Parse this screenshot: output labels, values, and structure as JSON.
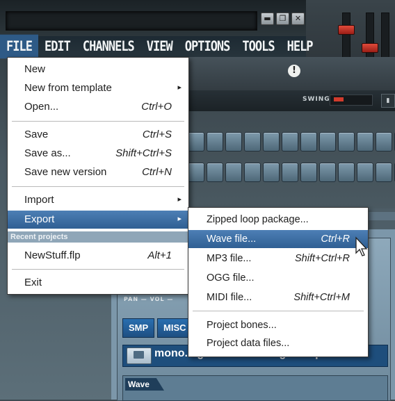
{
  "menubar": {
    "items": [
      "FILE",
      "EDIT",
      "CHANNELS",
      "VIEW",
      "OPTIONS",
      "TOOLS",
      "HELP"
    ]
  },
  "window_buttons": [
    "▬",
    "❐",
    "✕"
  ],
  "swing_label": "SWING",
  "file_menu": {
    "items": [
      {
        "label": "New",
        "shortcut": "",
        "submenu": false
      },
      {
        "label": "New from template",
        "shortcut": "",
        "submenu": true
      },
      {
        "label": "Open...",
        "shortcut": "Ctrl+O",
        "submenu": false
      },
      {
        "label": "Save",
        "shortcut": "Ctrl+S",
        "submenu": false
      },
      {
        "label": "Save as...",
        "shortcut": "Shift+Ctrl+S",
        "submenu": false
      },
      {
        "label": "Save new version",
        "shortcut": "Ctrl+N",
        "submenu": false
      },
      {
        "label": "Import",
        "shortcut": "",
        "submenu": true
      },
      {
        "label": "Export",
        "shortcut": "",
        "submenu": true
      },
      {
        "label": "NewStuff.flp",
        "shortcut": "Alt+1",
        "submenu": false
      },
      {
        "label": "Exit",
        "shortcut": "",
        "submenu": false
      }
    ],
    "recent_header": "Recent projects"
  },
  "export_menu": {
    "items": [
      {
        "label": "Zipped loop package...",
        "shortcut": ""
      },
      {
        "label": "Wave file...",
        "shortcut": "Ctrl+R"
      },
      {
        "label": "MP3 file...",
        "shortcut": "Shift+Ctrl+R"
      },
      {
        "label": "OGG file...",
        "shortcut": ""
      },
      {
        "label": "MIDI file...",
        "shortcut": "Shift+Ctrl+M"
      },
      {
        "label": "Project bones...",
        "shortcut": ""
      },
      {
        "label": "Project data files...",
        "shortcut": ""
      }
    ]
  },
  "channel": {
    "pan_vol": "PAN — VOL —",
    "tabs": [
      "SMP",
      "MISC"
    ],
    "project_name": "mono.leg beat of binking volmps",
    "wave_label": "Wave"
  },
  "colors": {
    "highlight": "#3d6fa4",
    "menubar_active": "#2e5a86",
    "knob_red": "#d23b2c"
  }
}
